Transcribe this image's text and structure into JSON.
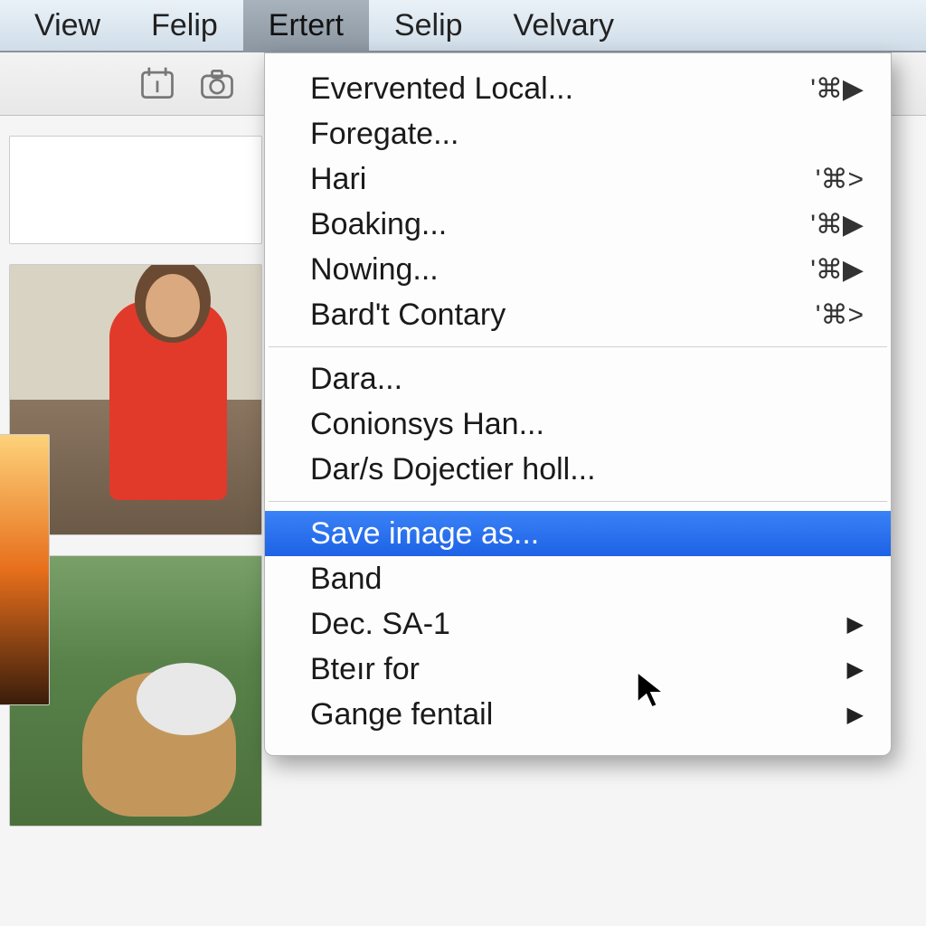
{
  "menubar": {
    "items": [
      {
        "label": "View",
        "active": false
      },
      {
        "label": "Felip",
        "active": false
      },
      {
        "label": "Ertert",
        "active": true
      },
      {
        "label": "Selip",
        "active": false
      },
      {
        "label": "Velvary",
        "active": false
      }
    ]
  },
  "toolbar": {
    "icons": [
      "calendar-icon",
      "camera-icon"
    ]
  },
  "dropdown": {
    "sections": [
      [
        {
          "label": "Evervented Local...",
          "shortcut": "'⌘▶"
        },
        {
          "label": "Foregate...",
          "shortcut": ""
        },
        {
          "label": "Hari",
          "shortcut": "'⌘>"
        },
        {
          "label": "Boaking...",
          "shortcut": "'⌘▶"
        },
        {
          "label": "Nowing...",
          "shortcut": "'⌘▶"
        },
        {
          "label": "Bard't Contary",
          "shortcut": "'⌘>"
        }
      ],
      [
        {
          "label": "Dara...",
          "shortcut": ""
        },
        {
          "label": "Conionsys Han...",
          "shortcut": ""
        },
        {
          "label": "Dar/s Dojectier holl...",
          "shortcut": ""
        }
      ],
      [
        {
          "label": "Save image as...",
          "shortcut": "",
          "highlighted": true
        },
        {
          "label": "Band",
          "shortcut": ""
        },
        {
          "label": "Dec. SA-1",
          "shortcut": "",
          "submenu": true
        },
        {
          "label": "Bteır for",
          "shortcut": "",
          "submenu": true
        },
        {
          "label": "Gange fentail",
          "shortcut": "",
          "submenu": true
        }
      ]
    ]
  }
}
